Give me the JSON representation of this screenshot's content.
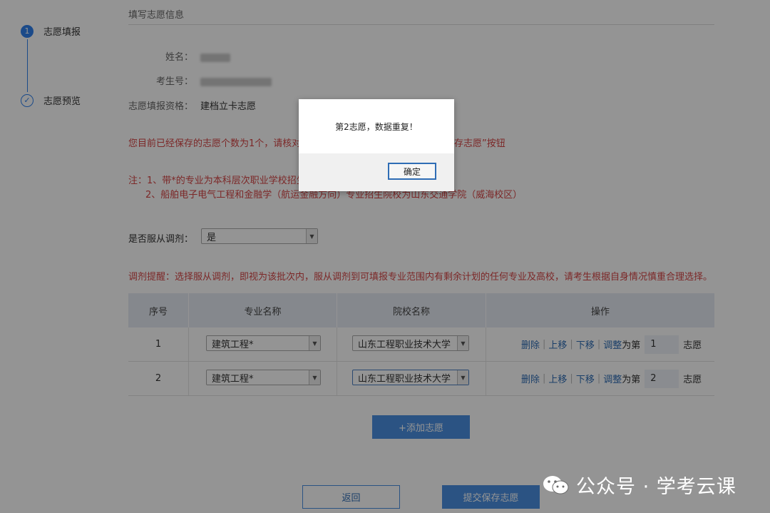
{
  "steps": [
    {
      "num": "1",
      "label": "志愿填报"
    },
    {
      "check": "✓",
      "label": "志愿预览"
    }
  ],
  "section_title": "填写志愿信息",
  "info": {
    "name_label": "姓名：",
    "exam_no_label": "考生号：",
    "qual_label": "志愿填报资格：",
    "qual_value": "建档立卡志愿"
  },
  "notice_saved": "您目前已经保存的志愿个数为1个，请核对",
  "notice_saved_tail": "存志愿”按钮",
  "note_1": "注：1、带*的专业为本科层次职业学校招生",
  "note_2": "2、船舶电子电气工程和金融学（航运金融方向）专业招生院校为山东交通学院（威海校区）",
  "adjust": {
    "label": "是否服从调剂：",
    "value": "是"
  },
  "adjust_tip": "调剂提醒：选择服从调剂，即视为该批次内，服从调剂到可填报专业范围内有剩余计划的任何专业及高校，请考生根据自身情况慎重合理选择。",
  "table": {
    "headers": [
      "序号",
      "专业名称",
      "院校名称",
      "操作"
    ],
    "rows": [
      {
        "index": "1",
        "major": "建筑工程*",
        "school": "山东工程职业技术大学",
        "order": "1"
      },
      {
        "index": "2",
        "major": "建筑工程*",
        "school": "山东工程职业技术大学",
        "order": "2"
      }
    ],
    "ops": {
      "delete": "删除",
      "up": "上移",
      "down": "下移",
      "adjust": "调整",
      "for_rank": "为第",
      "suffix": "志愿"
    }
  },
  "buttons": {
    "add": "+添加志愿",
    "back": "返回",
    "submit": "提交保存志愿"
  },
  "dialog": {
    "message": "第2志愿，数据重复！",
    "ok": "确定"
  },
  "watermark": "公众号 · 学考云课"
}
